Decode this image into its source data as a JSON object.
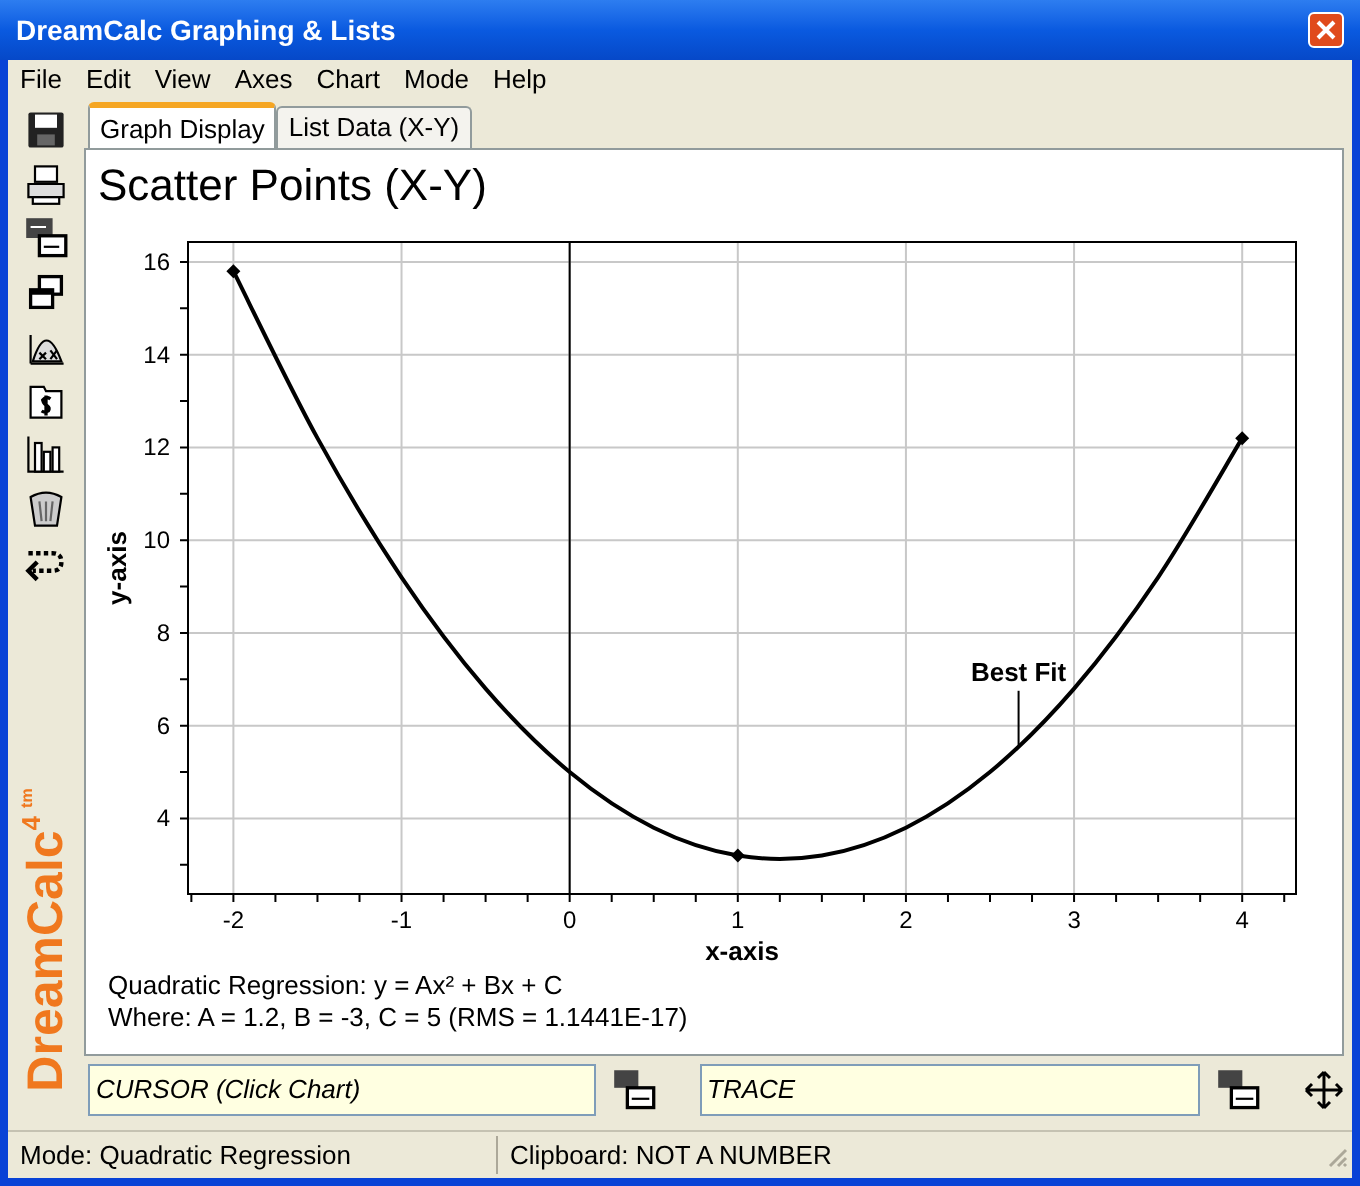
{
  "window": {
    "title": "DreamCalc Graphing & Lists"
  },
  "menu": [
    "File",
    "Edit",
    "View",
    "Axes",
    "Chart",
    "Mode",
    "Help"
  ],
  "logo": {
    "name": "DreamCalc",
    "version": "4",
    "mark": "tm"
  },
  "tabs": [
    {
      "label": "Graph Display",
      "selected": true
    },
    {
      "label": "List Data (X-Y)",
      "selected": false
    }
  ],
  "graph": {
    "title": "Scatter Points (X-Y)",
    "chart_data": {
      "type": "scatter",
      "xlabel": "x-axis",
      "ylabel": "y-axis",
      "x": [
        -2,
        -1.5,
        -1,
        -0.5,
        0,
        0.5,
        1,
        1.5,
        2,
        2.5,
        3,
        3.5,
        4
      ],
      "series": [
        {
          "type": "scatter",
          "color": "#000000",
          "values": [
            15.8,
            null,
            null,
            null,
            null,
            null,
            3.2,
            null,
            null,
            null,
            null,
            null,
            12.2
          ]
        },
        {
          "type": "line",
          "color": "#000000",
          "values": [
            15.8,
            12.2,
            9.2,
            6.8,
            5,
            3.8,
            3.2,
            3.2,
            3.8,
            5,
            6.8,
            9.2,
            12.2
          ]
        }
      ],
      "xlim": [
        -2.27,
        4.32
      ],
      "ylim": [
        2.37,
        16.43
      ],
      "xticks": [
        -2,
        -1,
        0,
        1,
        2,
        3,
        4
      ],
      "yticks": [
        4,
        6,
        8,
        10,
        12,
        14,
        16
      ],
      "grid": true,
      "annotations": [
        "Best Fit"
      ]
    },
    "regression": [
      "Quadratic Regression: y = Ax² + Bx + C",
      "Where: A = 1.2, B = -3, C = 5 (RMS = 1.1441E-17)"
    ]
  },
  "cursor_field": {
    "value": "CURSOR (Click Chart)"
  },
  "trace_field": {
    "value": "TRACE"
  },
  "status_bar": [
    "Mode: Quadratic Regression",
    "Clipboard: NOT A NUMBER"
  ]
}
